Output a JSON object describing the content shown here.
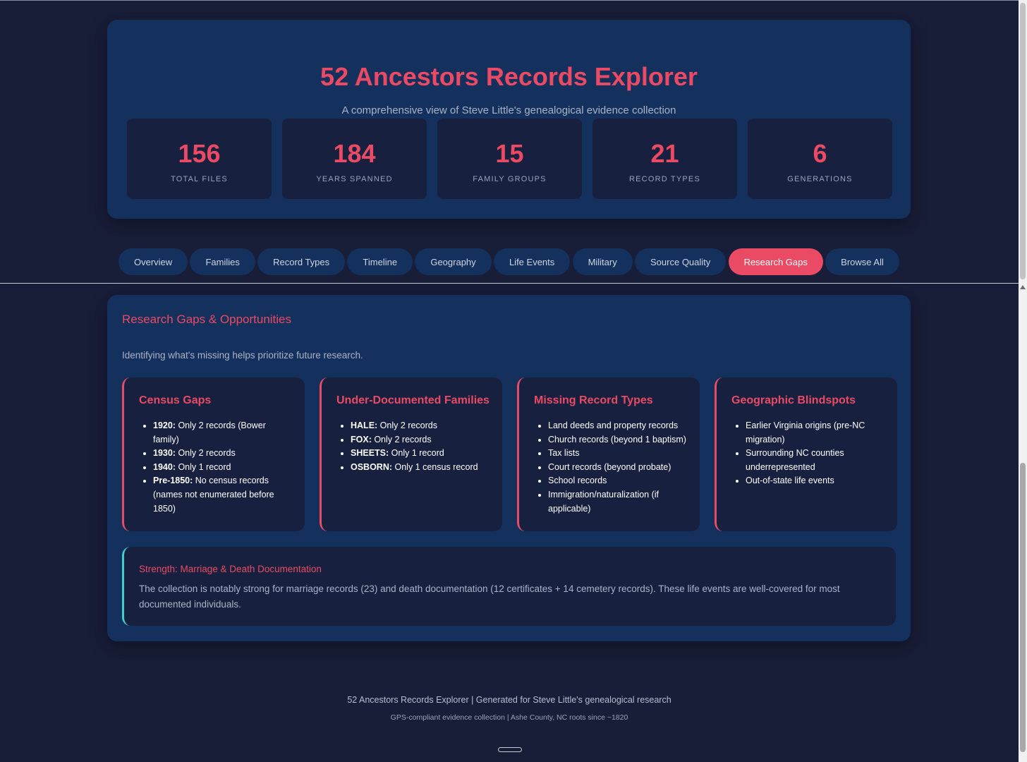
{
  "header": {
    "title": "52 Ancestors Records Explorer",
    "subtitle": "A comprehensive view of Steve Little's genealogical evidence collection"
  },
  "stats": [
    {
      "value": "156",
      "label": "TOTAL FILES"
    },
    {
      "value": "184",
      "label": "YEARS SPANNED"
    },
    {
      "value": "15",
      "label": "FAMILY GROUPS"
    },
    {
      "value": "21",
      "label": "RECORD TYPES"
    },
    {
      "value": "6",
      "label": "GENERATIONS"
    }
  ],
  "tabs": [
    {
      "label": "Overview"
    },
    {
      "label": "Families"
    },
    {
      "label": "Record Types"
    },
    {
      "label": "Timeline"
    },
    {
      "label": "Geography"
    },
    {
      "label": "Life Events"
    },
    {
      "label": "Military"
    },
    {
      "label": "Source Quality"
    },
    {
      "label": "Research Gaps",
      "active": true
    },
    {
      "label": "Browse All"
    }
  ],
  "panel": {
    "title": "Research Gaps & Opportunities",
    "description": "Identifying what's missing helps prioritize future research.",
    "cards": [
      {
        "title": "Census Gaps",
        "items": [
          {
            "bold": "1920:",
            "text": " Only 2 records (Bower family)"
          },
          {
            "bold": "1930:",
            "text": " Only 2 records"
          },
          {
            "bold": "1940:",
            "text": " Only 1 record"
          },
          {
            "bold": "Pre-1850:",
            "text": " No census records (names not enumerated before 1850)"
          }
        ]
      },
      {
        "title": "Under-Documented Families",
        "items": [
          {
            "bold": "HALE:",
            "text": " Only 2 records"
          },
          {
            "bold": "FOX:",
            "text": " Only 2 records"
          },
          {
            "bold": "SHEETS:",
            "text": " Only 1 record"
          },
          {
            "bold": "OSBORN:",
            "text": " Only 1 census record"
          }
        ]
      },
      {
        "title": "Missing Record Types",
        "items": [
          {
            "bold": "",
            "text": "Land deeds and property records"
          },
          {
            "bold": "",
            "text": "Church records (beyond 1 baptism)"
          },
          {
            "bold": "",
            "text": "Tax lists"
          },
          {
            "bold": "",
            "text": "Court records (beyond probate)"
          },
          {
            "bold": "",
            "text": "School records"
          },
          {
            "bold": "",
            "text": "Immigration/naturalization (if applicable)"
          }
        ]
      },
      {
        "title": "Geographic Blindspots",
        "items": [
          {
            "bold": "",
            "text": "Earlier Virginia origins (pre-NC migration)"
          },
          {
            "bold": "",
            "text": "Surrounding NC counties underrepresented"
          },
          {
            "bold": "",
            "text": "Out-of-state life events"
          }
        ]
      }
    ],
    "strength": {
      "title": "Strength: Marriage & Death Documentation",
      "text": "The collection is notably strong for marriage records (23) and death documentation (12 certificates + 14 cemetery records). These life events are well-covered for most documented individuals."
    }
  },
  "footer": {
    "line1": "52 Ancestors Records Explorer | Generated for Steve Little's genealogical research",
    "line2": "GPS-compliant evidence collection | Ashe County, NC roots since ~1820"
  },
  "colors": {
    "accent": "#ea4a63",
    "background": "#181d38",
    "card": "#14305c",
    "inner_card": "#17213f",
    "strength_border": "#3fd0c9"
  }
}
